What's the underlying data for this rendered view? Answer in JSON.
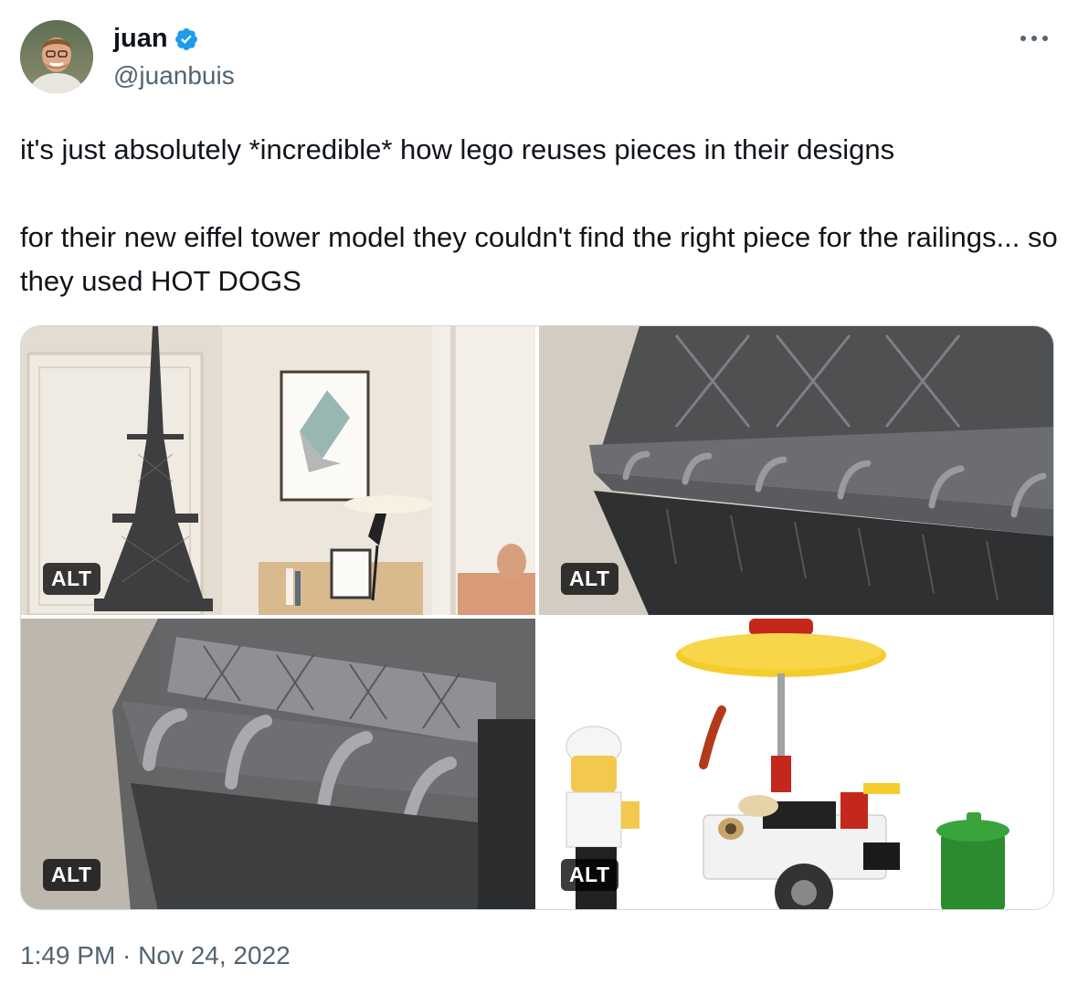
{
  "author": {
    "display_name": "juan",
    "handle": "@juanbuis",
    "verified": true
  },
  "tweet": {
    "paragraphs": [
      "it's just absolutely *incredible* how lego reuses pieces in their designs",
      "for their new eiffel tower model they couldn't find the right piece for the railings... so they used HOT DOGS"
    ],
    "timestamp": "1:49 PM · Nov 24, 2022"
  },
  "media": [
    {
      "alt_badge": "ALT"
    },
    {
      "alt_badge": "ALT"
    },
    {
      "alt_badge": "ALT"
    },
    {
      "alt_badge": "ALT"
    }
  ],
  "colors": {
    "text": "#0f1419",
    "secondary": "#536471",
    "verified_blue": "#1d9bf0",
    "border": "#cfd9de"
  },
  "icons": {
    "verified": "verified-badge-icon",
    "more": "more-horizontal-icon"
  }
}
